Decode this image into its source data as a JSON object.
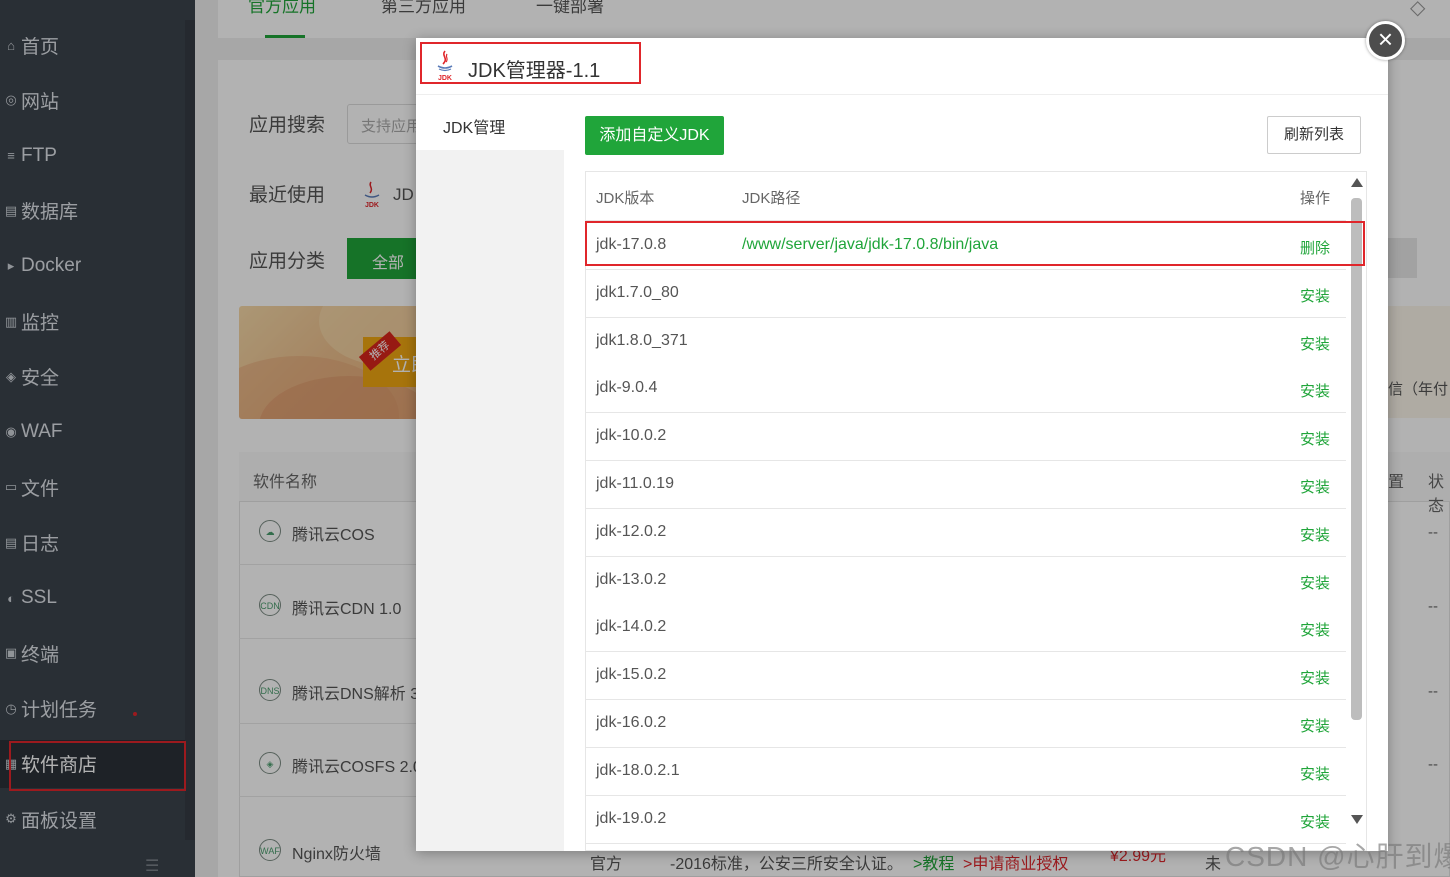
{
  "sidebar": {
    "items": [
      {
        "label": "首页",
        "icon": "home-icon"
      },
      {
        "label": "网站",
        "icon": "globe-icon"
      },
      {
        "label": "FTP",
        "icon": "ftp-icon"
      },
      {
        "label": "数据库",
        "icon": "database-icon"
      },
      {
        "label": "Docker",
        "icon": "docker-icon"
      },
      {
        "label": "监控",
        "icon": "monitor-icon"
      },
      {
        "label": "安全",
        "icon": "shield-icon"
      },
      {
        "label": "WAF",
        "icon": "waf-icon"
      },
      {
        "label": "文件",
        "icon": "folder-icon"
      },
      {
        "label": "日志",
        "icon": "log-icon"
      },
      {
        "label": "SSL",
        "icon": "ssl-icon"
      },
      {
        "label": "终端",
        "icon": "terminal-icon"
      },
      {
        "label": "计划任务",
        "icon": "clock-icon"
      },
      {
        "label": "软件商店",
        "icon": "store-icon"
      },
      {
        "label": "面板设置",
        "icon": "settings-icon"
      }
    ],
    "active": "软件商店"
  },
  "background": {
    "tabs": [
      "官方应用",
      "第三方应用",
      "一键部署"
    ],
    "search_label": "应用搜索",
    "search_placeholder": "支持应用",
    "recent_label": "最近使用",
    "recent_item": "JD",
    "category_label": "应用分类",
    "category_all": "全部",
    "banner_badge": "推荐",
    "banner_text": "立即",
    "right_text_1": "信（年付",
    "right_col_1": "置",
    "right_col_2": "状态",
    "table_header": "软件名称",
    "rows": [
      {
        "name": "腾讯云COS",
        "icon": "cloud-icon"
      },
      {
        "name": "腾讯云CDN 1.0",
        "icon": "cdn-icon"
      },
      {
        "name": "腾讯云DNS解析 3",
        "icon": "dns-icon"
      },
      {
        "name": "腾讯云COSFS 2.0",
        "icon": "cosfs-icon"
      },
      {
        "name": "Nginx防火墙",
        "icon": "waf-icon"
      }
    ],
    "dash": "--",
    "bottom_official": "官方",
    "bottom_desc": "-2016标准，公安三所安全认证。",
    "bottom_tutorial": ">教程",
    "bottom_apply": ">申请商业授权",
    "bottom_price": "¥2.99元",
    "bottom_trail": "未",
    "watermark": "CSDN @心肝到爆"
  },
  "modal": {
    "title": "JDK管理器-1.1",
    "logo_text": "JDK",
    "sidebar_item": "JDK管理",
    "add_button": "添加自定义JDK",
    "refresh_button": "刷新列表",
    "columns": [
      "JDK版本",
      "JDK路径",
      "操作"
    ],
    "rows": [
      {
        "version": "jdk-17.0.8",
        "path": "/www/server/java/jdk-17.0.8/bin/java",
        "action": "删除"
      },
      {
        "version": "jdk1.7.0_80",
        "path": "",
        "action": "安装"
      },
      {
        "version": "jdk1.8.0_371",
        "path": "",
        "action": "安装"
      },
      {
        "version": "jdk-9.0.4",
        "path": "",
        "action": "安装"
      },
      {
        "version": "jdk-10.0.2",
        "path": "",
        "action": "安装"
      },
      {
        "version": "jdk-11.0.19",
        "path": "",
        "action": "安装"
      },
      {
        "version": "jdk-12.0.2",
        "path": "",
        "action": "安装"
      },
      {
        "version": "jdk-13.0.2",
        "path": "",
        "action": "安装"
      },
      {
        "version": "jdk-14.0.2",
        "path": "",
        "action": "安装"
      },
      {
        "version": "jdk-15.0.2",
        "path": "",
        "action": "安装"
      },
      {
        "version": "jdk-16.0.2",
        "path": "",
        "action": "安装"
      },
      {
        "version": "jdk-18.0.2.1",
        "path": "",
        "action": "安装"
      },
      {
        "version": "jdk-19.0.2",
        "path": "",
        "action": "安装"
      }
    ]
  },
  "colors": {
    "accent": "#20a53a",
    "sidebar_bg": "#3c444d",
    "highlight": "#e0262b"
  }
}
